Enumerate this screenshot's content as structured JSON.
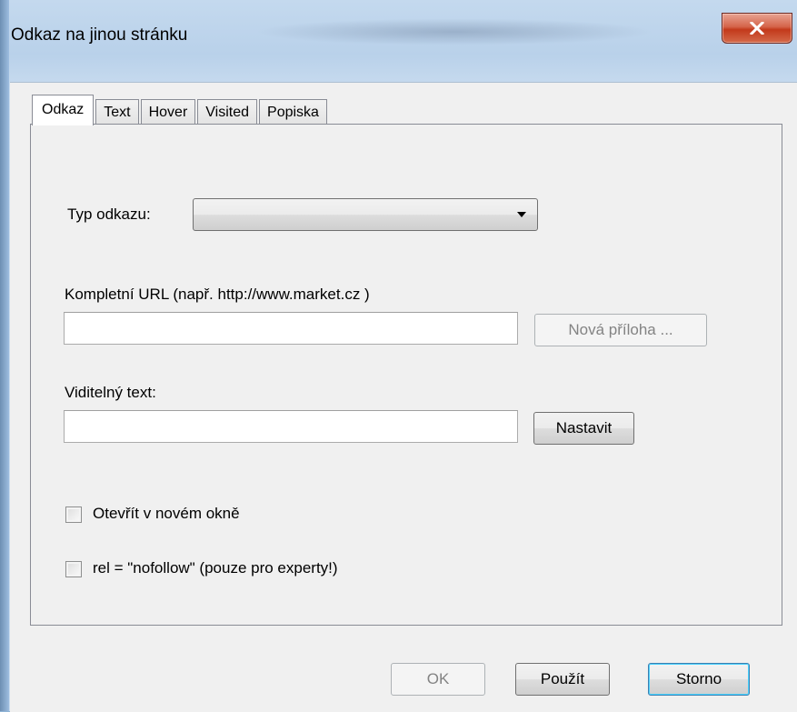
{
  "window": {
    "title": "Odkaz na jinou stránku",
    "close_label": "X"
  },
  "tabs": [
    {
      "label": "Odkaz",
      "active": true
    },
    {
      "label": "Text",
      "active": false
    },
    {
      "label": "Hover",
      "active": false
    },
    {
      "label": "Visited",
      "active": false
    },
    {
      "label": "Popiska",
      "active": false
    }
  ],
  "form": {
    "link_type_label": "Typ odkazu:",
    "link_type_value": "",
    "url_label": "Kompletní URL (např. http://www.market.cz )",
    "url_value": "",
    "new_attachment_button": "Nová příloha ...",
    "visible_text_label": "Viditelný text:",
    "visible_text_value": "",
    "set_button": "Nastavit",
    "open_new_window_label": "Otevřít v novém okně",
    "nofollow_label": "rel = \"nofollow\" (pouze pro experty!)"
  },
  "footer": {
    "ok_button": "OK",
    "apply_button": "Použít",
    "cancel_button": "Storno"
  }
}
